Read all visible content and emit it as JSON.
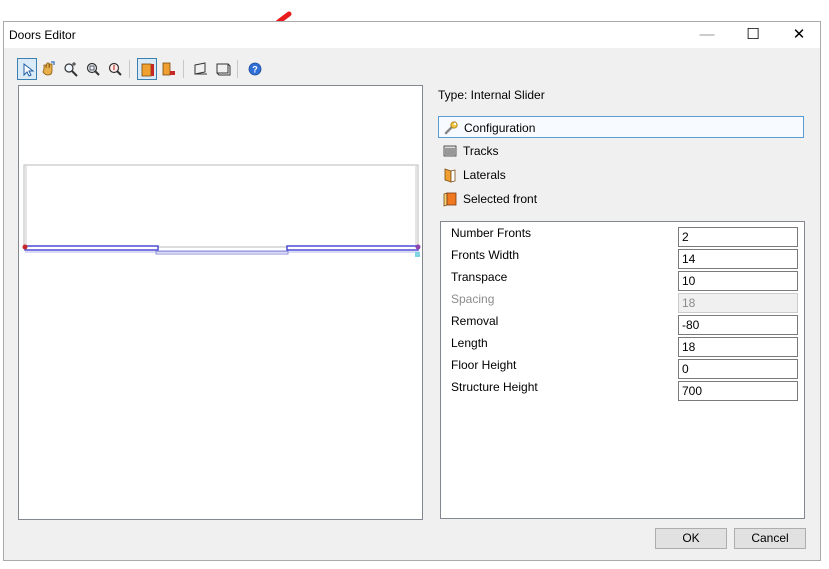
{
  "window": {
    "title": "Doors Editor",
    "minimize_glyph": "—",
    "maximize_glyph": "☐",
    "close_glyph": "✕"
  },
  "toolbar": {
    "buttons": [
      {
        "name": "select-pointer-icon",
        "active": true
      },
      {
        "name": "pan-hand-icon"
      },
      {
        "name": "zoom-in-icon"
      },
      {
        "name": "zoom-extents-icon"
      },
      {
        "name": "zoom-out-icon"
      },
      {
        "name": "front-view-icon",
        "active": true
      },
      {
        "name": "side-view-icon"
      },
      {
        "name": "perspective-left-icon"
      },
      {
        "name": "perspective-right-icon"
      },
      {
        "name": "help-icon"
      }
    ]
  },
  "panel": {
    "type_label": "Type: Internal Slider",
    "categories": [
      {
        "label": "Configuration",
        "icon": "wrench-icon",
        "selected": true
      },
      {
        "label": "Tracks",
        "icon": "tracks-icon"
      },
      {
        "label": "Laterals",
        "icon": "laterals-icon"
      },
      {
        "label": "Selected front",
        "icon": "selected-front-icon"
      }
    ],
    "properties": [
      {
        "label": "Number Fronts",
        "value": "2"
      },
      {
        "label": "Fronts Width",
        "value": "14"
      },
      {
        "label": "Transpace",
        "value": "10"
      },
      {
        "label": "Spacing",
        "value": "18",
        "disabled": true
      },
      {
        "label": "Removal",
        "value": "-80"
      },
      {
        "label": "Length",
        "value": "18"
      },
      {
        "label": "Floor Height",
        "value": "0"
      },
      {
        "label": "Structure Height",
        "value": "700"
      }
    ]
  },
  "buttons": {
    "ok": "OK",
    "cancel": "Cancel"
  },
  "colors": {
    "annotation_arrow": "#e81c1c",
    "selection_border": "#5b9bd5",
    "track_blue": "#4b4bd6"
  }
}
